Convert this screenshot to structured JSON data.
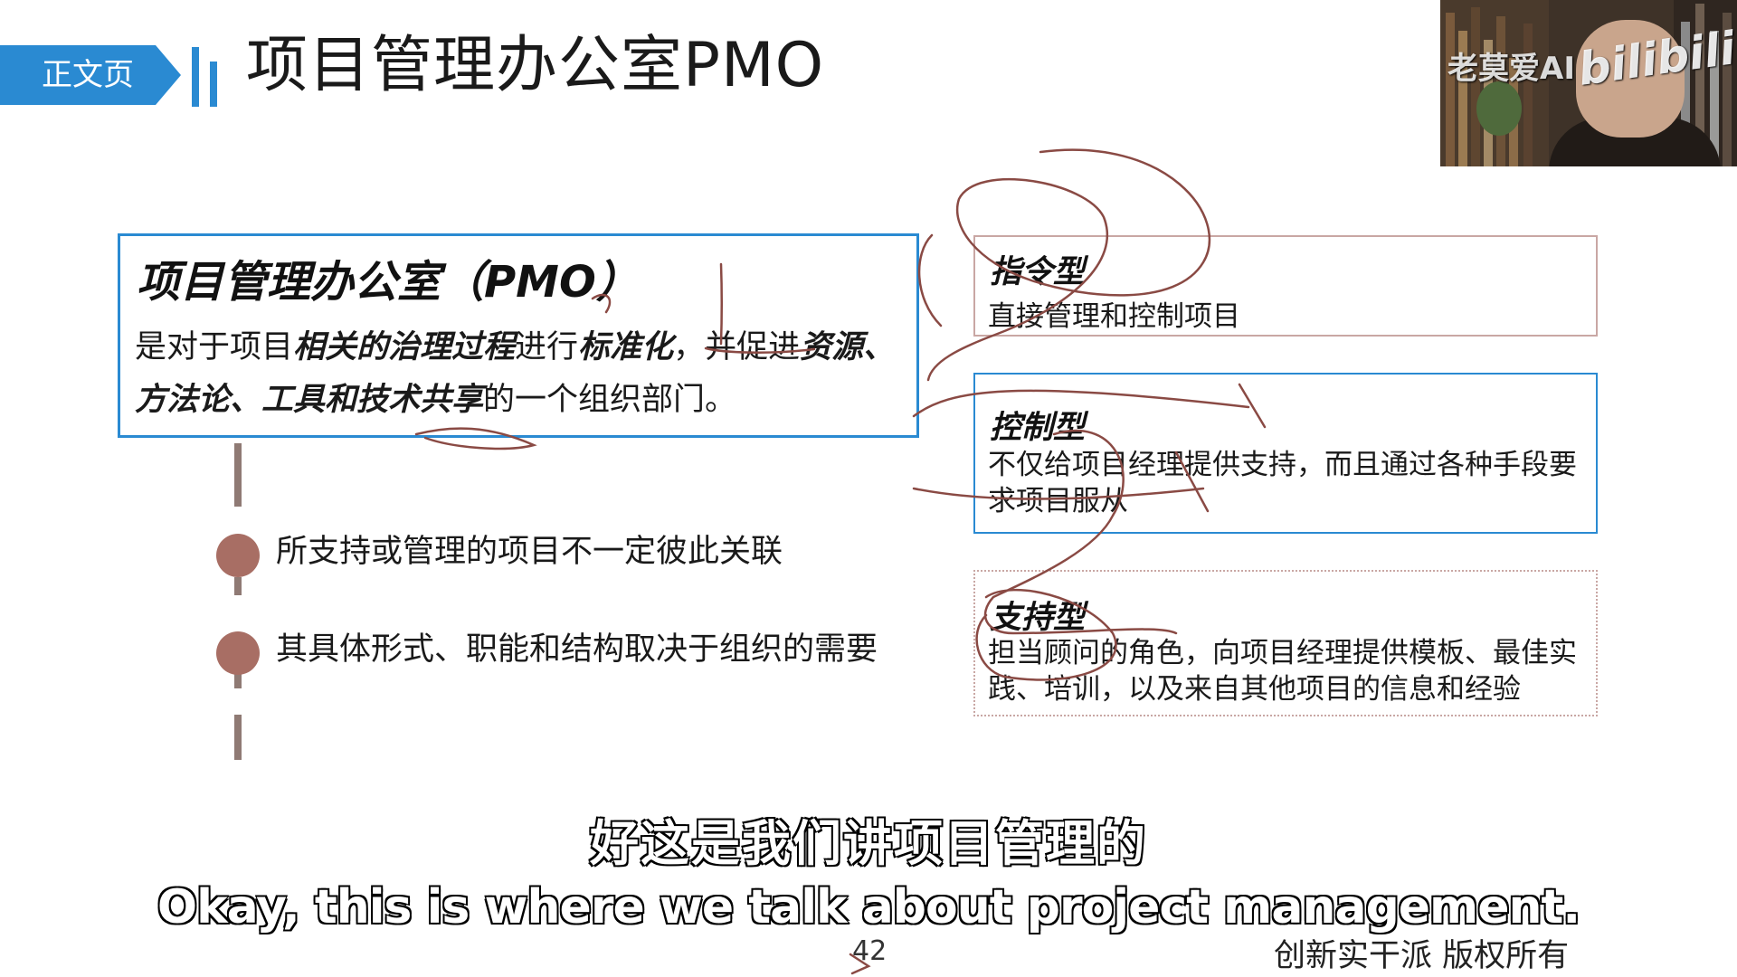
{
  "header": {
    "section_tag": "正文页",
    "title": "项目管理办公室PMO"
  },
  "watermark": {
    "channel": "老莫爱AI",
    "logo": "bilibili"
  },
  "definition": {
    "title": "项目管理办公室（PMO）",
    "body_parts": [
      "是对于项目",
      "相关的治理过程",
      "进行",
      "标准化",
      "，并促进",
      "资源、方法论、工具和技术共享",
      "的一个组织部门。"
    ]
  },
  "bullets": [
    "所支持或管理的项目不一定彼此关联",
    "其具体形式、职能和结构取决于组织的需要"
  ],
  "types": [
    {
      "title": "指令型",
      "desc": "直接管理和控制项目"
    },
    {
      "title": "控制型",
      "desc": "不仅给项目经理提供支持，而且通过各种手段要求项目服从"
    },
    {
      "title": "支持型",
      "desc": "担当顾问的角色，向项目经理提供模板、最佳实践、培训，以及来自其他项目的信息和经验"
    }
  ],
  "colors": {
    "accent_blue": "#2a8ad2",
    "card_border_red": "#c9a7a4",
    "timeline": "#a86e64",
    "annotation_ink": "#8a4a44"
  },
  "subtitle": {
    "cn": "好这是我们讲项目管理的",
    "en": "Okay, this is where we talk about project management."
  },
  "footer": {
    "page_number": "42",
    "copyright": "创新实干派  版权所有"
  }
}
